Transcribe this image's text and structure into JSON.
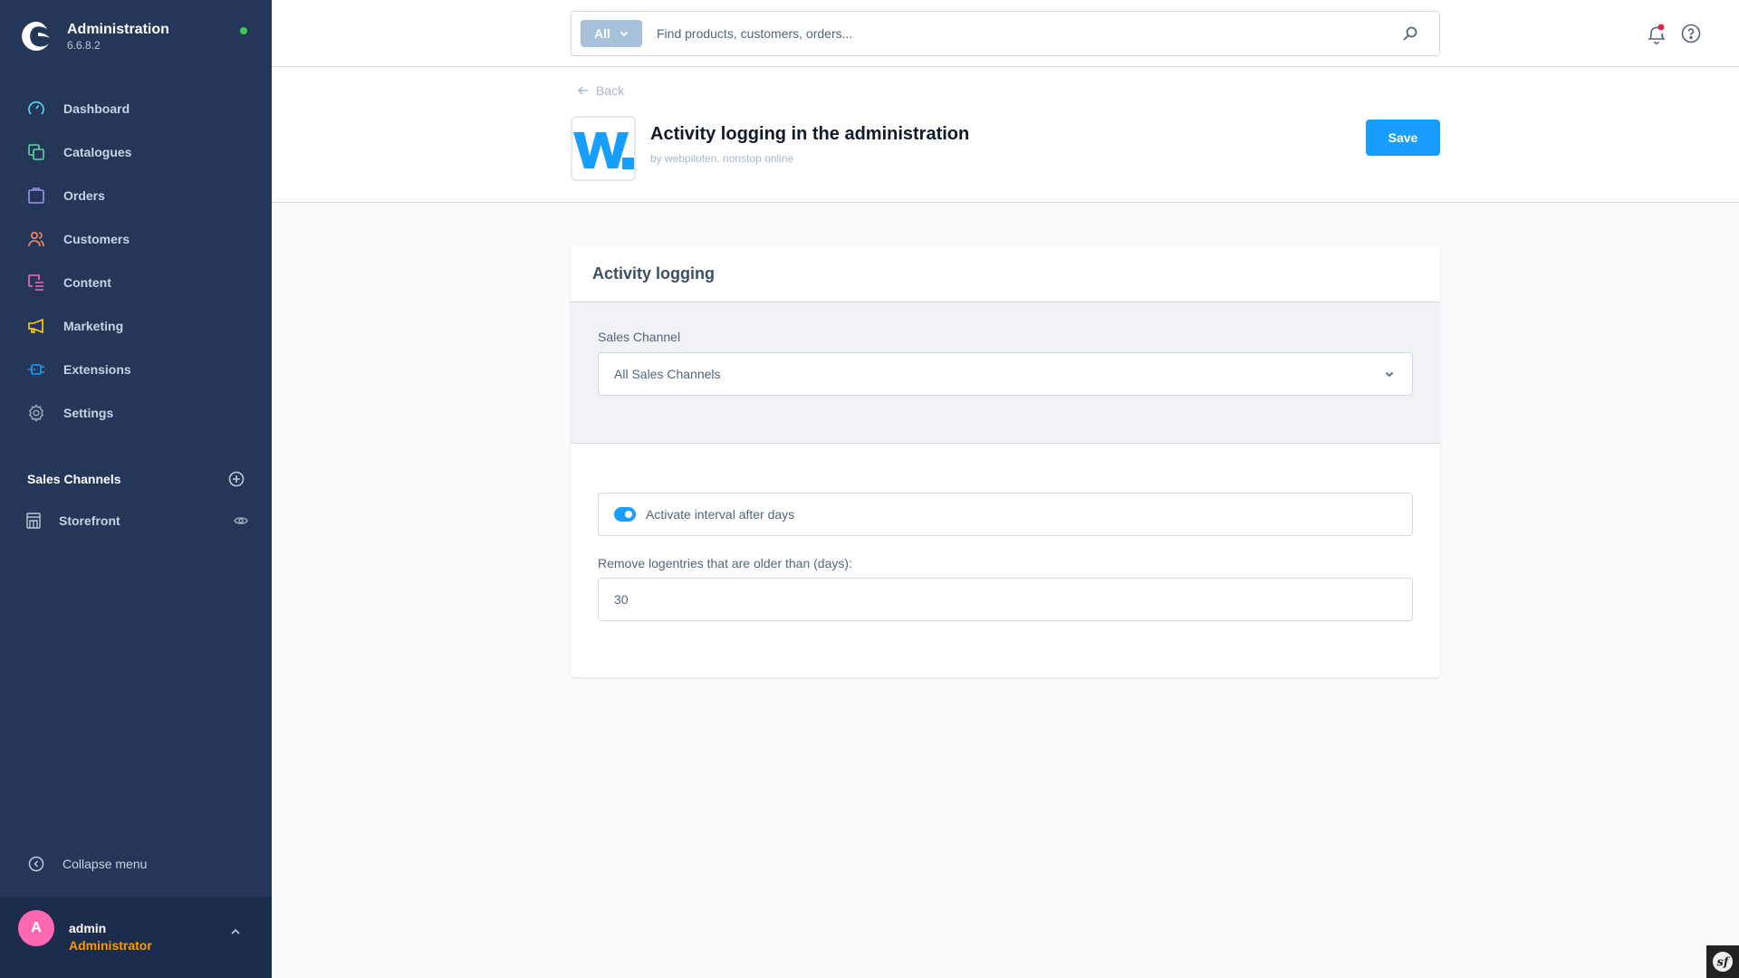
{
  "brand": {
    "title": "Administration",
    "version": "6.6.8.2",
    "status_color": "#37d046"
  },
  "sidebar": {
    "items": [
      {
        "label": "Dashboard",
        "icon": "dashboard-gauge-icon",
        "color": "#57d9ef"
      },
      {
        "label": "Catalogues",
        "icon": "catalogues-icon",
        "color": "#57d9a3"
      },
      {
        "label": "Orders",
        "icon": "shopping-bag-icon",
        "color": "#a092f0"
      },
      {
        "label": "Customers",
        "icon": "users-icon",
        "color": "#f88962"
      },
      {
        "label": "Content",
        "icon": "content-icon",
        "color": "#ff68b4"
      },
      {
        "label": "Marketing",
        "icon": "megaphone-icon",
        "color": "#ffd700"
      },
      {
        "label": "Extensions",
        "icon": "plug-icon",
        "color": "#189eff"
      },
      {
        "label": "Settings",
        "icon": "gear-icon",
        "color": "#9aa8b5"
      }
    ],
    "sales_channels_title": "Sales Channels",
    "sales_channels": [
      {
        "label": "Storefront",
        "icon": "storefront-icon"
      }
    ],
    "collapse_label": "Collapse menu"
  },
  "user": {
    "initial": "A",
    "name": "admin",
    "role": "Administrator"
  },
  "search": {
    "type_label": "All",
    "placeholder": "Find products, customers, orders..."
  },
  "page": {
    "back_label": "Back",
    "app_title": "Activity logging in the administration",
    "app_subtitle": "by webpiloten. nonstop online",
    "save_label": "Save"
  },
  "card": {
    "title": "Activity logging",
    "sales_channel_label": "Sales Channel",
    "sales_channel_value": "All Sales Channels",
    "interval_toggle_label": "Activate interval after days",
    "interval_toggle_on": true,
    "days_label": "Remove logentries that are older than (days):",
    "days_value": "30"
  }
}
